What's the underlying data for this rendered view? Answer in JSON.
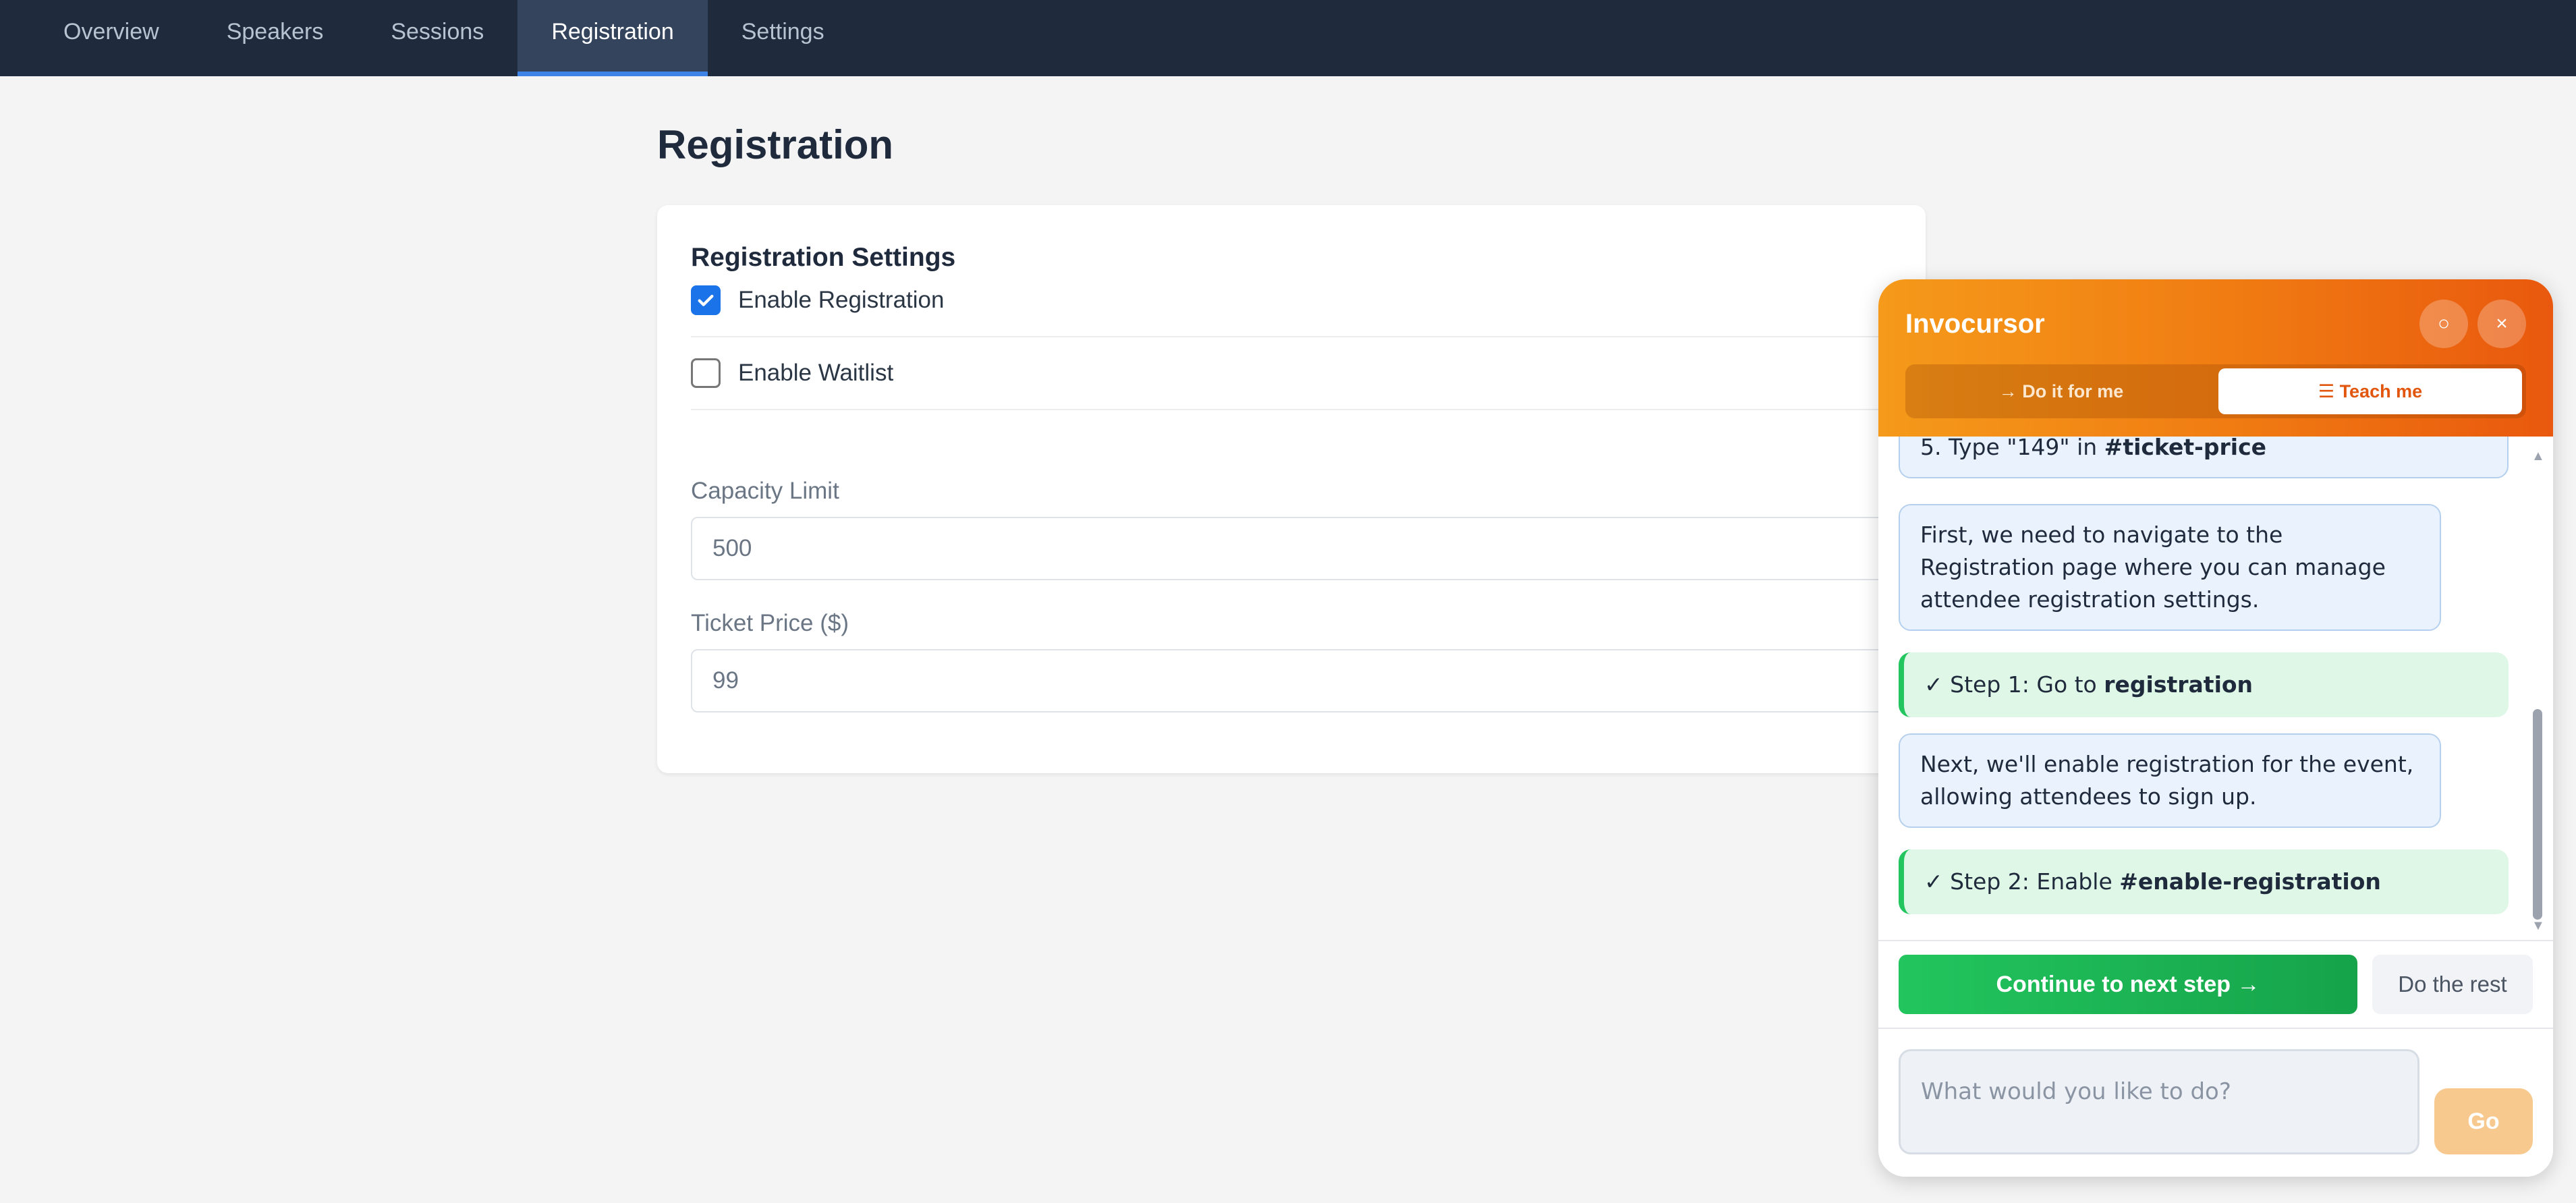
{
  "nav": {
    "tabs": [
      {
        "label": "Overview"
      },
      {
        "label": "Speakers"
      },
      {
        "label": "Sessions"
      },
      {
        "label": "Registration"
      },
      {
        "label": "Settings"
      }
    ],
    "active": "Registration"
  },
  "page": {
    "title": "Registration"
  },
  "card": {
    "title": "Registration Settings",
    "enable_registration": {
      "label": "Enable Registration",
      "checked": true
    },
    "enable_waitlist": {
      "label": "Enable Waitlist",
      "checked": false
    },
    "capacity": {
      "label": "Capacity Limit",
      "value": "500"
    },
    "ticket_price": {
      "label": "Ticket Price ($)",
      "value": "99"
    }
  },
  "assistant": {
    "title": "Invocursor",
    "minimize_icon": "○",
    "close_icon": "×",
    "modes": {
      "do": "→ Do it for me",
      "teach": "☰ Teach me",
      "active": "teach"
    },
    "messages": [
      {
        "type": "info",
        "prefix": "5. Type \"149\" in ",
        "bold": "#ticket-price"
      },
      {
        "type": "info",
        "text": "First, we need to navigate to the Registration page where you can manage attendee registration settings."
      },
      {
        "type": "step",
        "prefix": "✓ Step 1: Go to ",
        "bold": "registration"
      },
      {
        "type": "info",
        "text": "Next, we'll enable registration for the event, allowing attendees to sign up."
      },
      {
        "type": "step",
        "prefix": "✓ Step 2: Enable ",
        "bold": "#enable-registration"
      }
    ],
    "continue_label": "Continue to next step →",
    "rest_label": "Do the rest",
    "input_placeholder": "What would you like to do?",
    "go_label": "Go"
  },
  "colors": {
    "nav_bg": "#1f2a3c",
    "nav_active_indicator": "#3d84e6",
    "checkbox_checked": "#1a73e8",
    "panel_header_start": "#f59a1a",
    "panel_header_end": "#e9580e",
    "step_green": "#22c55e",
    "go_button": "#f8c98e"
  }
}
